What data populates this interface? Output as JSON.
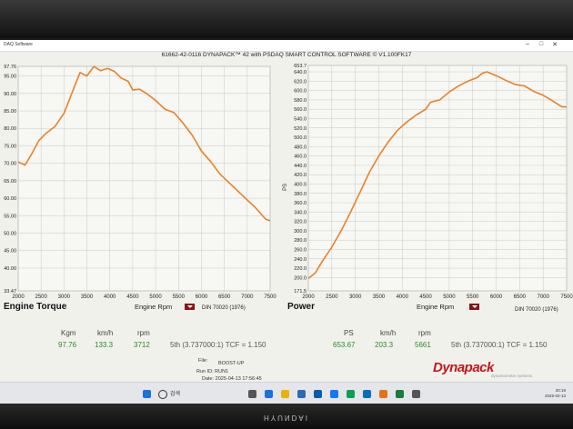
{
  "window": {
    "title": "DAQ Software",
    "header": "61662-42-0116 DYNAPACK™ 42 with PSDAQ SMART CONTROL SOFTWARE © V1.100FK17"
  },
  "torque_panel": {
    "title": "Engine Torque",
    "rpm_label": "Engine Rpm",
    "std_label": "DIN 70020 (1976)",
    "readout": {
      "labels": [
        "Kgm",
        "km/h",
        "rpm"
      ],
      "values": [
        "97.76",
        "133.3",
        "3712"
      ],
      "gear": "5th (3.737000:1) TCF = 1.150"
    }
  },
  "power_panel": {
    "title": "Power",
    "ylabel": "PS",
    "rpm_label": "Engine Rpm",
    "std_label": "DIN 70020 (1976)",
    "readout": {
      "labels": [
        "PS",
        "km/h",
        "rpm"
      ],
      "values": [
        "653.67",
        "203.3",
        "5661"
      ],
      "gear": "5th (3.737000:1) TCF = 1.150"
    }
  },
  "run_info": {
    "file_label": "File:",
    "file": "BOOST-UP",
    "run": "Run ID: RUN1",
    "date": "Date: 2025-04-13 17:56:45"
  },
  "taskbar": {
    "search": "검색",
    "time": "20:19",
    "date": "2025-04-13"
  },
  "logo": {
    "text": "Dynapack",
    "tagline": "dynamometer systems"
  },
  "monitor": {
    "brand": "HYUNDAI"
  },
  "colors": {
    "curve": "#e8822a",
    "grid": "#c9c9c9",
    "readout": "#2a8a2a",
    "logo": "#c4161c"
  },
  "chart_data": [
    {
      "type": "line",
      "title": "Engine Torque",
      "xlabel": "Engine Rpm",
      "ylabel": "",
      "xlim": [
        2000,
        7500
      ],
      "ylim": [
        33.47,
        97.76
      ],
      "xticks": [
        2000,
        2500,
        3000,
        3500,
        4000,
        4500,
        5000,
        5500,
        6000,
        6500,
        7000,
        7500
      ],
      "yticks": [
        "97.76",
        "95.00",
        "90.00",
        "85.00",
        "80.00",
        "75.00",
        "70.00",
        "65.00",
        "60.00",
        "55.00",
        "50.00",
        "45.00",
        "40.00",
        "33.47"
      ],
      "ytick_values": [
        97.76,
        95,
        90,
        85,
        80,
        75,
        70,
        65,
        60,
        55,
        50,
        45,
        40,
        33.47
      ],
      "series": [
        {
          "x": [
            2000,
            2150,
            2300,
            2450,
            2600,
            2800,
            3000,
            3200,
            3350,
            3500,
            3650,
            3800,
            3950,
            4100,
            4250,
            4400,
            4500,
            4650,
            4800,
            5000,
            5200,
            5400,
            5600,
            5800,
            6000,
            6200,
            6400,
            6600,
            6800,
            7000,
            7200,
            7400,
            7500
          ],
          "y": [
            70.4,
            69.5,
            72.8,
            76.5,
            78.5,
            80.5,
            84.3,
            91.0,
            96.0,
            95.0,
            97.7,
            96.5,
            97.2,
            96.3,
            94.4,
            93.5,
            91.0,
            91.2,
            90.0,
            88.0,
            85.5,
            84.5,
            81.5,
            78.0,
            73.5,
            70.5,
            67.0,
            64.5,
            62.0,
            59.5,
            57.0,
            54.0,
            53.5
          ]
        }
      ]
    },
    {
      "type": "line",
      "title": "Power",
      "xlabel": "Engine Rpm",
      "ylabel": "PS",
      "xlim": [
        2000,
        7500
      ],
      "ylim": [
        171.5,
        653.7
      ],
      "xticks": [
        2000,
        2500,
        3000,
        3500,
        4000,
        4500,
        5000,
        5500,
        6000,
        6500,
        7000,
        7500
      ],
      "yticks": [
        "653.7",
        "640.0",
        "620.0",
        "600.0",
        "580.0",
        "560.0",
        "540.0",
        "520.0",
        "500.0",
        "480.0",
        "460.0",
        "440.0",
        "420.0",
        "400.0",
        "380.0",
        "360.0",
        "340.0",
        "320.0",
        "300.0",
        "280.0",
        "260.0",
        "240.0",
        "220.0",
        "200.0",
        "171.5"
      ],
      "ytick_values": [
        653.7,
        640,
        620,
        600,
        580,
        560,
        540,
        520,
        500,
        480,
        460,
        440,
        420,
        400,
        380,
        360,
        340,
        320,
        300,
        280,
        260,
        240,
        220,
        200,
        171.5
      ],
      "series": [
        {
          "x": [
            2000,
            2150,
            2300,
            2500,
            2700,
            2900,
            3100,
            3300,
            3500,
            3700,
            3900,
            4100,
            4300,
            4500,
            4600,
            4800,
            5000,
            5200,
            5400,
            5600,
            5700,
            5800,
            6000,
            6200,
            6400,
            6600,
            6800,
            7000,
            7200,
            7400,
            7500
          ],
          "y": [
            198,
            210,
            235,
            265,
            300,
            340,
            382,
            425,
            460,
            490,
            515,
            533,
            548,
            560,
            575,
            580,
            597,
            610,
            620,
            628,
            637,
            640,
            632,
            622,
            613,
            610,
            598,
            590,
            578,
            565,
            565
          ]
        }
      ]
    }
  ]
}
